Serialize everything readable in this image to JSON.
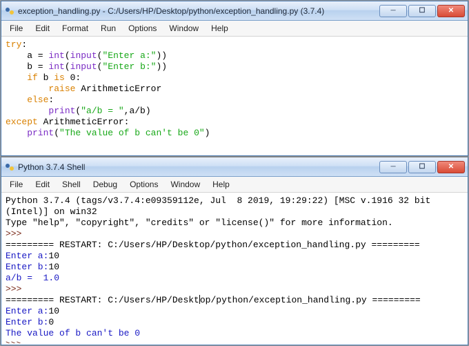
{
  "editor": {
    "title": "exception_handling.py - C:/Users/HP/Desktop/python/exception_handling.py (3.7.4)",
    "menus": [
      "File",
      "Edit",
      "Format",
      "Run",
      "Options",
      "Window",
      "Help"
    ],
    "code": {
      "l1_try": "try",
      "l2_a": "    a = ",
      "l2_int": "int",
      "l2_paren1": "(",
      "l2_input": "input",
      "l2_paren2": "(",
      "l2_str": "\"Enter a:\"",
      "l2_end": "))",
      "l3_b": "    b = ",
      "l3_int": "int",
      "l3_paren1": "(",
      "l3_input": "input",
      "l3_paren2": "(",
      "l3_str": "\"Enter b:\"",
      "l3_end": "))",
      "l4_if": "    if",
      "l4_cond": " b ",
      "l4_is": "is",
      "l4_zero": " 0:",
      "l5_raise": "        raise",
      "l5_err": " ArithmeticError",
      "l6_else": "    else",
      "l6_colon": ":",
      "l7_print": "        print",
      "l7_paren": "(",
      "l7_str": "\"a/b = \"",
      "l7_rest": ",a/b)",
      "l8_except": "except",
      "l8_err": " ArithmeticError:",
      "l9_print": "    print",
      "l9_paren": "(",
      "l9_str": "\"The value of b can't be 0\"",
      "l9_end": ")"
    }
  },
  "shell": {
    "title": "Python 3.7.4 Shell",
    "menus": [
      "File",
      "Edit",
      "Shell",
      "Debug",
      "Options",
      "Window",
      "Help"
    ],
    "banner1": "Python 3.7.4 (tags/v3.7.4:e09359112e, Jul  8 2019, 19:29:22) [MSC v.1916 32 bit",
    "banner2": "(Intel)] on win32",
    "banner3": "Type \"help\", \"copyright\", \"credits\" or \"license()\" for more information.",
    "prompt": ">>>",
    "restart1a": "========= RESTART: C:/Users/HP/Desktop/python/exception_handling.py =========",
    "enter_a1": "Enter a:",
    "val_a1": "10",
    "enter_b1": "Enter b:",
    "val_b1": "10",
    "result1": "a/b =  1.0",
    "restart2a": "========= RESTART: C:/Users/HP/Deskt",
    "restart2b": "p/python/exception_handling.py =========",
    "restart2mid": "o",
    "enter_a2": "Enter a:",
    "val_a2": "10",
    "enter_b2": "Enter b:",
    "val_b2": "0",
    "result2": "The value of b can't be 0"
  },
  "icon_glyph": "🐍"
}
